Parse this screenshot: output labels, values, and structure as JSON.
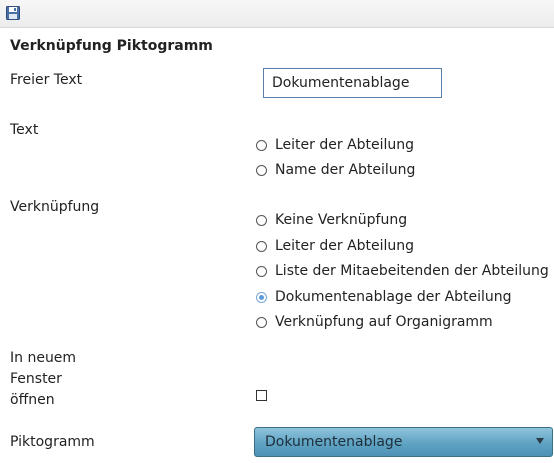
{
  "toolbar": {
    "save_icon": "floppy-disk-icon"
  },
  "section": {
    "title": "Verknüpfung Piktogramm"
  },
  "freier_text": {
    "label": "Freier Text",
    "value": "Dokumentenablage"
  },
  "text": {
    "label": "Text",
    "options": [
      {
        "label": "Leiter der Abteilung",
        "checked": false
      },
      {
        "label": "Name der Abteilung",
        "checked": false
      }
    ]
  },
  "verknuepfung": {
    "label": "Verknüpfung",
    "options": [
      {
        "label": "Keine Verknüpfung",
        "checked": false
      },
      {
        "label": "Leiter der Abteilung",
        "checked": false
      },
      {
        "label": "Liste der Mitaebeitenden der Abteilung",
        "checked": false
      },
      {
        "label": "Dokumentenablage der Abteilung",
        "checked": true
      },
      {
        "label": "Verknüpfung auf Organigramm",
        "checked": false
      }
    ]
  },
  "neues_fenster": {
    "label_line1": "In neuem",
    "label_line2": "Fenster",
    "label_line3": "öffnen",
    "checked": false
  },
  "piktogramm": {
    "label": "Piktogramm",
    "selected": "Dokumentenablage"
  },
  "colors": {
    "select_gradient_top": "#8fc3dc",
    "select_gradient_bottom": "#4d92b6",
    "radio_checked": "#5d9ad9",
    "input_border": "#5a7fa8"
  }
}
